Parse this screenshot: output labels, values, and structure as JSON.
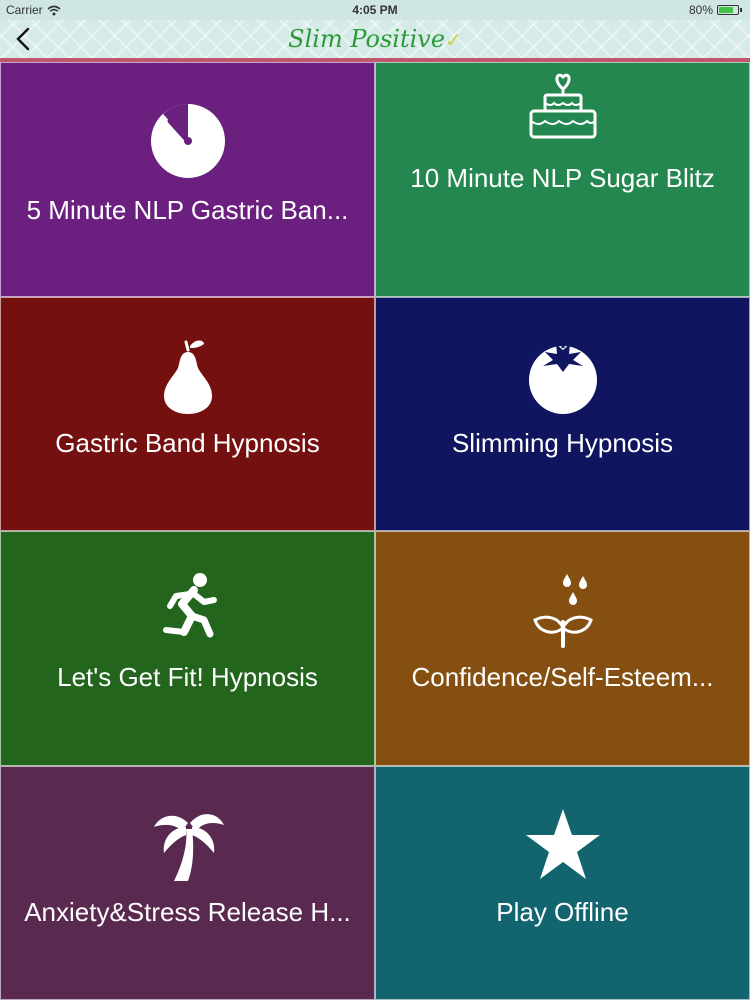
{
  "status_bar": {
    "carrier": "Carrier",
    "time": "4:05 PM",
    "battery": "80%",
    "battery_level": 0.8
  },
  "nav": {
    "title": "Slim Positive",
    "title_check": "✓"
  },
  "colors": {
    "tile_0": "#6b1f7e",
    "tile_1": "#23874f",
    "tile_2": "#751010",
    "tile_3": "#101560",
    "tile_4": "#23651d",
    "tile_5": "#844f10",
    "tile_6": "#59294f",
    "tile_7": "#12646f"
  },
  "tiles": [
    {
      "label": "5 Minute NLP Gastric Ban...",
      "icon": "timer-icon"
    },
    {
      "label": "10 Minute NLP Sugar Blitz",
      "icon": "cake-icon"
    },
    {
      "label": "Gastric Band Hypnosis",
      "icon": "pear-icon"
    },
    {
      "label": "Slimming Hypnosis",
      "icon": "tomato-icon"
    },
    {
      "label": "Let's Get Fit! Hypnosis",
      "icon": "runner-icon"
    },
    {
      "label": "Confidence/Self-Esteem...",
      "icon": "sprout-icon"
    },
    {
      "label": "Anxiety&Stress Release H...",
      "icon": "palm-tree-icon"
    },
    {
      "label": "Play Offline",
      "icon": "star-icon"
    }
  ]
}
